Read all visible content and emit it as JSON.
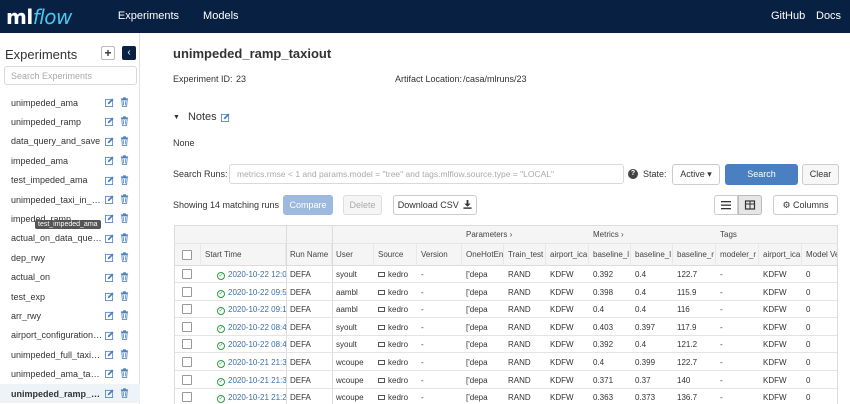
{
  "topbar": {
    "logo_ml": "ml",
    "logo_flow": "flow",
    "nav": [
      "Experiments",
      "Models"
    ],
    "right": [
      "GitHub",
      "Docs"
    ]
  },
  "sidebar": {
    "title": "Experiments",
    "add": "+",
    "collapse": "‹",
    "search_placeholder": "Search Experiments",
    "tooltip": "test_impeded_ama",
    "items": [
      {
        "label": "unimpeded_ama"
      },
      {
        "label": "unimpeded_ramp"
      },
      {
        "label": "data_query_and_save"
      },
      {
        "label": "impeded_ama"
      },
      {
        "label": "test_impeded_ama"
      },
      {
        "label": "unimpeded_taxi_in_ama"
      },
      {
        "label": "impeded_ramp"
      },
      {
        "label": "actual_on_data_query_and_save"
      },
      {
        "label": "dep_rwy"
      },
      {
        "label": "actual_on"
      },
      {
        "label": "test_exp"
      },
      {
        "label": "arr_rwy"
      },
      {
        "label": "airport_configuration_data"
      },
      {
        "label": "unimpeded_full_taxiout"
      },
      {
        "label": "unimpeded_ama_taxiout"
      },
      {
        "label": "unimpeded_ramp_taxiout"
      }
    ]
  },
  "main": {
    "title": "unimpeded_ramp_taxiout",
    "experiment_id_label": "Experiment ID:",
    "experiment_id": "23",
    "artifact_label": "Artifact Location:",
    "artifact": "/casa/mlruns/23",
    "notes_label": "Notes",
    "notes_body": "None",
    "search_label": "Search Runs:",
    "search_placeholder": "metrics.rmse < 1 and params.model = \"tree\" and tags.mlflow.source.type = \"LOCAL\"",
    "state_label": "State:",
    "state_value": "Active ▾",
    "search_btn": "Search",
    "clear_btn": "Clear",
    "matching": "Showing 14 matching runs",
    "compare_btn": "Compare",
    "delete_btn": "Delete",
    "csv_btn": "Download CSV",
    "columns_btn": "Columns"
  },
  "table": {
    "groups": [
      "Parameters ›",
      "Metrics ›",
      "Tags"
    ],
    "headers": [
      "Start Time",
      "Run Name",
      "User",
      "Source",
      "Version",
      "OneHotEn",
      "Train_test",
      "airport_ica",
      "baseline_l",
      "baseline_l",
      "baseline_r",
      "modeler_r",
      "airport_ica",
      "Model Ver"
    ],
    "rows": [
      [
        "2020-10-22 12:0",
        "DEFA",
        "syoult",
        "kedro",
        "-",
        "['depa",
        "RAND",
        "KDFW",
        "0.392",
        "0.4",
        "122.7",
        "-",
        "KDFW",
        "0"
      ],
      [
        "2020-10-22 09:5",
        "DEFA",
        "aambl",
        "kedro",
        "-",
        "['depa",
        "RAND",
        "KDFW",
        "0.398",
        "0.4",
        "115.9",
        "-",
        "KDFW",
        "0"
      ],
      [
        "2020-10-22 09:1",
        "DEFA",
        "aambl",
        "kedro",
        "-",
        "['depa",
        "RAND",
        "KDFW",
        "0.4",
        "0.4",
        "116",
        "-",
        "KDFW",
        "0"
      ],
      [
        "2020-10-22 08:4",
        "DEFA",
        "syoult",
        "kedro",
        "-",
        "['depa",
        "RAND",
        "KDFW",
        "0.403",
        "0.397",
        "117.9",
        "-",
        "KDFW",
        "0"
      ],
      [
        "2020-10-22 08:4",
        "DEFA",
        "syoult",
        "kedro",
        "-",
        "['depa",
        "RAND",
        "KDFW",
        "0.392",
        "0.4",
        "121.2",
        "-",
        "KDFW",
        "0"
      ],
      [
        "2020-10-21 21:3",
        "DEFA",
        "wcoupe",
        "kedro",
        "-",
        "['depa",
        "RAND",
        "KDFW",
        "0.4",
        "0.399",
        "122.7",
        "-",
        "KDFW",
        "0"
      ],
      [
        "2020-10-21 21:3",
        "DEFA",
        "wcoupe",
        "kedro",
        "-",
        "['depa",
        "RAND",
        "KDFW",
        "0.371",
        "0.37",
        "140",
        "-",
        "KDFW",
        "0"
      ],
      [
        "2020-10-21 21:2",
        "DEFA",
        "wcoupe",
        "kedro",
        "-",
        "['depa",
        "RAND",
        "KDFW",
        "0.363",
        "0.373",
        "136.7",
        "-",
        "KDFW",
        "0"
      ]
    ]
  }
}
